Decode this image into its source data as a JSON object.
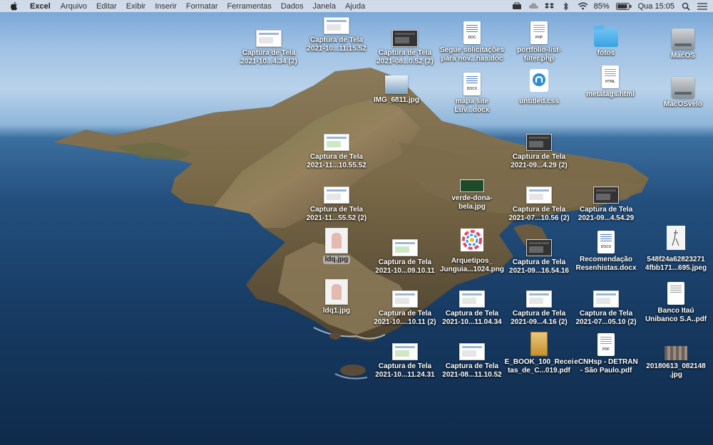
{
  "menubar": {
    "app_name": "Excel",
    "menus": [
      "Arquivo",
      "Editar",
      "Exibir",
      "Inserir",
      "Formatar",
      "Ferramentas",
      "Dados",
      "Janela",
      "Ajuda"
    ],
    "battery": "85%",
    "clock": "Qua 15:05"
  },
  "desktop": {
    "icons": [
      {
        "label": "Captura de Tela\n2021-10...4.34 (2)",
        "kind": "screenshot"
      },
      {
        "label": "Captura de Tela\n2021-10...11.15.52",
        "kind": "screenshot"
      },
      {
        "label": "Captura de Tela\n2021-08...0.52 (2)",
        "kind": "screenshot-dark"
      },
      {
        "label": "Segue solicitações\npara nov...has.doc",
        "kind": "doc",
        "badge": "DOC"
      },
      {
        "label": "portfolio-list-\nfilter.php",
        "kind": "doc",
        "badge": "PHP"
      },
      {
        "label": "fotos",
        "kind": "folder"
      },
      {
        "label": "MacOS",
        "kind": "drive"
      },
      {
        "label": "IMG_6811.jpg",
        "kind": "image"
      },
      {
        "label": "mapa site\nLuv...docx",
        "kind": "doc",
        "badge": "DOCX"
      },
      {
        "label": "untitled.css",
        "kind": "css"
      },
      {
        "label": "metatags.html",
        "kind": "doc",
        "badge": "HTML"
      },
      {
        "label": "MacOSvelo",
        "kind": "drive"
      },
      {
        "label": "Captura de Tela\n2021-11...10.55.52",
        "kind": "screenshot-green"
      },
      {
        "label": "Captura de Tela\n2021-09...4.29 (2)",
        "kind": "screenshot-dark"
      },
      {
        "label": "verde-dona-\nbela.jpg",
        "kind": "image-green"
      },
      {
        "label": "Captura de Tela\n2021-11...55.52 (2)",
        "kind": "screenshot"
      },
      {
        "label": "Captura de Tela\n2021-07...10.56 (2)",
        "kind": "screenshot"
      },
      {
        "label": "Captura de Tela\n2021-09...4.54.29",
        "kind": "screenshot-dark"
      },
      {
        "label": "ldq.jpg",
        "kind": "photo",
        "selected": true
      },
      {
        "label": "Captura de Tela\n2021-10...09.10.11",
        "kind": "screenshot-green"
      },
      {
        "label": "Arquetipos_\nJunguia...1024.png",
        "kind": "wheel"
      },
      {
        "label": "Captura de Tela\n2021-09...16.54.16",
        "kind": "screenshot-dark"
      },
      {
        "label": "Recomendação\nResenhistas.docx",
        "kind": "doc",
        "badge": "DOCX"
      },
      {
        "label": "548f24a62823271\n4fbb171...695.jpeg",
        "kind": "sketch"
      },
      {
        "label": "ldq1.jpg",
        "kind": "photo"
      },
      {
        "label": "Captura de Tela\n2021-10....10.11 (2)",
        "kind": "screenshot"
      },
      {
        "label": "Captura de Tela\n2021-10...11.04.34",
        "kind": "screenshot"
      },
      {
        "label": "Captura de Tela\n2021-09...4.16 (2)",
        "kind": "screenshot"
      },
      {
        "label": "Captura de Tela\n2021-07...05.10 (2)",
        "kind": "screenshot"
      },
      {
        "label": "Banco Itaú\nUnibanco S.A..pdf",
        "kind": "doc",
        "badge": ""
      },
      {
        "label": "Captura de Tela\n2021-10...11.24.31",
        "kind": "screenshot-green"
      },
      {
        "label": "Captura de Tela\n2021-08...11.10.52",
        "kind": "screenshot"
      },
      {
        "label": "E_BOOK_100_Recei\ntas_de_C...019.pdf",
        "kind": "book"
      },
      {
        "label": "eCNHsp - DETRAN\n- São Paulo.pdf",
        "kind": "doc",
        "badge": "PDF"
      },
      {
        "label": "20180613_082148\n.jpg",
        "kind": "image-wide"
      }
    ]
  }
}
